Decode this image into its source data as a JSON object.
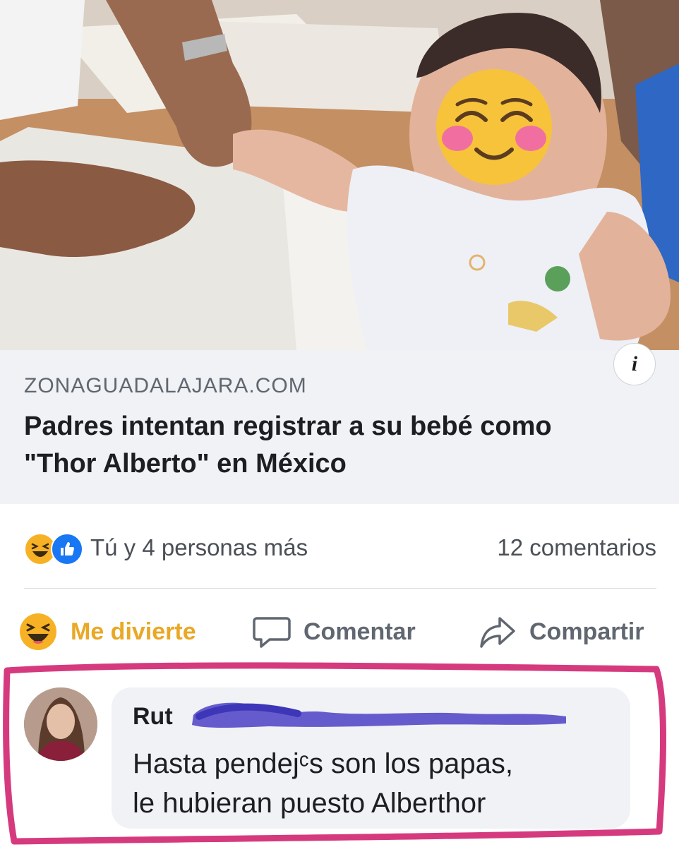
{
  "post": {
    "link_domain": "ZONAGUADALAJARA.COM",
    "headline": "Padres intentan registrar a su bebé como \"Thor Alberto\" en México",
    "info_icon": "i"
  },
  "reactions": {
    "icons": [
      "laugh-reaction-icon",
      "like-reaction-icon"
    ],
    "summary": "Tú y 4 personas más",
    "comments_count": "12 comentarios"
  },
  "actions": {
    "react_label": "Me divierte",
    "comment_label": "Comentar",
    "share_label": "Compartir"
  },
  "comment": {
    "author": "Rut",
    "text_line1": "Hasta pendejᶜs son los papas,",
    "text_line2": "le hubieran puesto Alberthor"
  },
  "colors": {
    "reaction_active": "#e9a825",
    "link_card_bg": "#f0f2f5",
    "highlight_border": "#d63a7e",
    "redaction_scribble": "#5a4ec8"
  }
}
